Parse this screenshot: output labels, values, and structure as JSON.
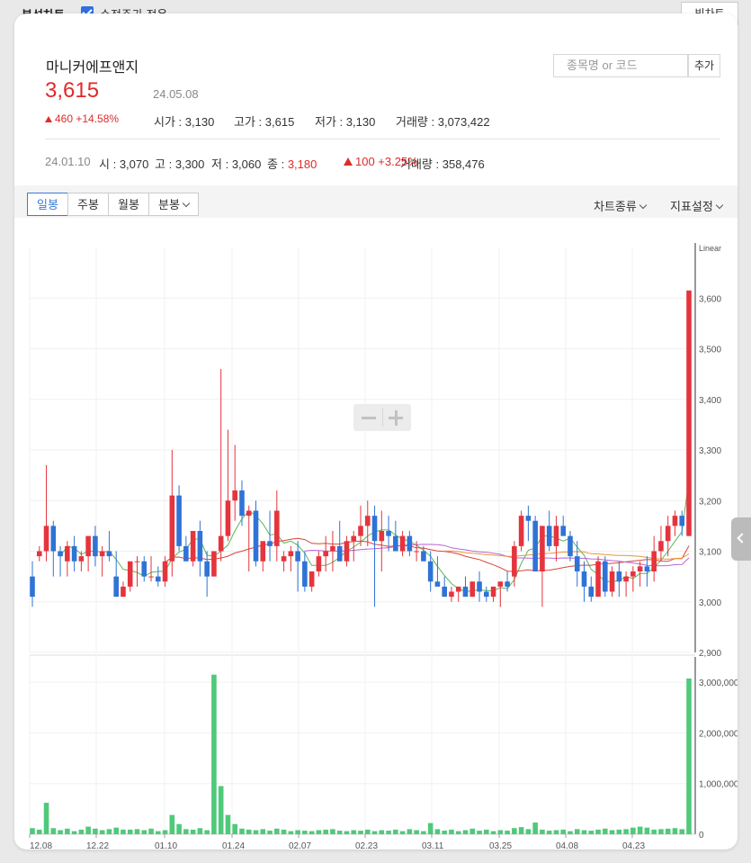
{
  "topbar": {
    "title": "분석차트",
    "adjusted_label": "수정주가 적용",
    "big_chart_label": "빅차트"
  },
  "stock": {
    "name": "마니커에프앤지",
    "price": "3,615",
    "date": "24.05.08",
    "change": "460 +14.58%",
    "ohlc": [
      {
        "label": "시가",
        "value": "3,130"
      },
      {
        "label": "고가",
        "value": "3,615"
      },
      {
        "label": "저가",
        "value": "3,130"
      },
      {
        "label": "거래량",
        "value": "3,073,422"
      }
    ]
  },
  "search": {
    "placeholder": "종목명 or 코드",
    "add_label": "추가"
  },
  "history": {
    "date": "24.01.10",
    "open_label": "시",
    "open": "3,070",
    "high_label": "고",
    "high": "3,300",
    "low_label": "저",
    "low": "3,060",
    "close_label": "종",
    "close": "3,180",
    "change": "100 +3.25%",
    "volume_label": "거래량",
    "volume": "358,476"
  },
  "tabs": [
    "일봉",
    "주봉",
    "월봉",
    "분봉"
  ],
  "menus": {
    "chart_type": "차트종류",
    "indicator": "지표설정"
  },
  "colors": {
    "up": "#e5343d",
    "down": "#2f73d6",
    "ma5": "#5ab65a",
    "ma20": "#d9453b",
    "ma60": "#b665d6",
    "ma120": "#e8963a",
    "volume": "#4fc97a"
  },
  "chart_data": [
    {
      "type": "candlestick",
      "scale_label": "Linear",
      "ylim": [
        2900,
        3700
      ],
      "yticks": [
        "3,600",
        "3,500",
        "3,400",
        "3,300",
        "3,200",
        "3,100",
        "3,000",
        "2,900"
      ],
      "xticks": [
        "12.08",
        "12.22",
        "01.10",
        "01.24",
        "02.07",
        "02.23",
        "03.11",
        "03.25",
        "04.08",
        "04.23"
      ],
      "candles": [
        [
          3050,
          3080,
          2990,
          3010
        ],
        [
          3090,
          3110,
          3080,
          3100
        ],
        [
          3100,
          3270,
          3080,
          3150
        ],
        [
          3150,
          3160,
          3050,
          3100
        ],
        [
          3100,
          3110,
          3050,
          3090
        ],
        [
          3080,
          3120,
          3050,
          3110
        ],
        [
          3110,
          3130,
          3060,
          3080
        ],
        [
          3080,
          3100,
          3060,
          3090
        ],
        [
          3090,
          3110,
          3060,
          3130
        ],
        [
          3130,
          3150,
          3070,
          3090
        ],
        [
          3090,
          3110,
          3050,
          3100
        ],
        [
          3100,
          3140,
          3080,
          3090
        ],
        [
          3050,
          3100,
          3030,
          3010
        ],
        [
          3010,
          3040,
          3010,
          3030
        ],
        [
          3030,
          3060,
          3020,
          3080
        ],
        [
          3080,
          3090,
          3030,
          3080
        ],
        [
          3080,
          3090,
          3040,
          3050
        ],
        [
          3050,
          3090,
          3040,
          3050
        ],
        [
          3050,
          3070,
          3030,
          3040
        ],
        [
          3040,
          3090,
          3030,
          3080
        ],
        [
          3080,
          3300,
          3050,
          3210
        ],
        [
          3210,
          3230,
          3100,
          3110
        ],
        [
          3110,
          3130,
          3080,
          3080
        ],
        [
          3080,
          3120,
          3070,
          3140
        ],
        [
          3140,
          3160,
          3050,
          3080
        ],
        [
          3080,
          3100,
          3010,
          3050
        ],
        [
          3050,
          3100,
          3060,
          3100
        ],
        [
          3100,
          3460,
          3080,
          3130
        ],
        [
          3130,
          3340,
          3120,
          3200
        ],
        [
          3200,
          3310,
          3160,
          3220
        ],
        [
          3220,
          3240,
          3150,
          3170
        ],
        [
          3170,
          3190,
          3060,
          3180
        ],
        [
          3180,
          3200,
          3070,
          3080
        ],
        [
          3080,
          3110,
          3060,
          3120
        ],
        [
          3120,
          3180,
          3080,
          3110
        ],
        [
          3110,
          3220,
          3080,
          3180
        ],
        [
          3080,
          3100,
          3060,
          3090
        ],
        [
          3090,
          3110,
          3060,
          3100
        ],
        [
          3100,
          3120,
          3020,
          3080
        ],
        [
          3080,
          3100,
          3020,
          3030
        ],
        [
          3030,
          3060,
          3020,
          3060
        ],
        [
          3060,
          3100,
          3050,
          3090
        ],
        [
          3090,
          3130,
          3060,
          3100
        ],
        [
          3100,
          3140,
          3060,
          3110
        ],
        [
          3110,
          3160,
          3080,
          3080
        ],
        [
          3080,
          3130,
          3070,
          3120
        ],
        [
          3120,
          3140,
          3080,
          3130
        ],
        [
          3130,
          3190,
          3110,
          3150
        ],
        [
          3150,
          3200,
          3110,
          3170
        ],
        [
          3170,
          3190,
          2990,
          3120
        ],
        [
          3120,
          3180,
          3060,
          3140
        ],
        [
          3140,
          3170,
          3100,
          3130
        ],
        [
          3130,
          3160,
          3100,
          3100
        ],
        [
          3100,
          3140,
          3090,
          3130
        ],
        [
          3130,
          3140,
          3090,
          3100
        ],
        [
          3100,
          3120,
          3080,
          3100
        ],
        [
          3100,
          3110,
          3090,
          3080
        ],
        [
          3080,
          3100,
          3020,
          3040
        ],
        [
          3040,
          3090,
          3030,
          3030
        ],
        [
          3030,
          3050,
          3010,
          3010
        ],
        [
          3010,
          3030,
          3000,
          3020
        ],
        [
          3020,
          3030,
          3000,
          3030
        ],
        [
          3030,
          3050,
          3010,
          3010
        ],
        [
          3010,
          3040,
          3010,
          3040
        ],
        [
          3040,
          3060,
          3000,
          3020
        ],
        [
          3020,
          3030,
          3000,
          3010
        ],
        [
          3010,
          3030,
          3000,
          3030
        ],
        [
          3030,
          3040,
          2990,
          3040
        ],
        [
          3040,
          3060,
          3020,
          3030
        ],
        [
          3050,
          3120,
          3030,
          3110
        ],
        [
          3110,
          3180,
          3100,
          3170
        ],
        [
          3170,
          3190,
          3120,
          3160
        ],
        [
          3160,
          3170,
          3060,
          3060
        ],
        [
          3060,
          3140,
          2990,
          3150
        ],
        [
          3150,
          3180,
          3100,
          3110
        ],
        [
          3110,
          3170,
          3080,
          3150
        ],
        [
          3150,
          3170,
          3130,
          3130
        ],
        [
          3130,
          3140,
          3080,
          3090
        ],
        [
          3090,
          3120,
          3030,
          3060
        ],
        [
          3060,
          3080,
          3000,
          3030
        ],
        [
          3030,
          3050,
          3000,
          3010
        ],
        [
          3010,
          3090,
          3010,
          3080
        ],
        [
          3080,
          3090,
          3010,
          3020
        ],
        [
          3020,
          3070,
          3010,
          3060
        ],
        [
          3060,
          3080,
          3010,
          3040
        ],
        [
          3040,
          3060,
          3010,
          3050
        ],
        [
          3050,
          3070,
          3020,
          3060
        ],
        [
          3060,
          3080,
          3030,
          3070
        ],
        [
          3070,
          3090,
          3030,
          3060
        ],
        [
          3060,
          3130,
          3040,
          3100
        ],
        [
          3100,
          3150,
          3080,
          3120
        ],
        [
          3120,
          3170,
          3090,
          3150
        ],
        [
          3150,
          3180,
          3130,
          3170
        ],
        [
          3170,
          3180,
          3130,
          3150
        ],
        [
          3130,
          3615,
          3130,
          3615
        ]
      ]
    },
    {
      "type": "bar",
      "title": "",
      "ylim": [
        0,
        3500000
      ],
      "yticks": [
        "3,000,000",
        "2,000,000",
        "1,000,000",
        "0"
      ],
      "values": [
        120000,
        90000,
        620000,
        120000,
        80000,
        110000,
        60000,
        90000,
        150000,
        110000,
        80000,
        100000,
        130000,
        90000,
        90000,
        100000,
        80000,
        110000,
        60000,
        80000,
        380000,
        200000,
        100000,
        90000,
        120000,
        80000,
        3150000,
        950000,
        380000,
        200000,
        110000,
        90000,
        80000,
        100000,
        70000,
        110000,
        90000,
        60000,
        80000,
        70000,
        60000,
        80000,
        90000,
        100000,
        70000,
        60000,
        80000,
        70000,
        90000,
        60000,
        80000,
        70000,
        90000,
        60000,
        100000,
        80000,
        60000,
        220000,
        100000,
        70000,
        90000,
        60000,
        80000,
        110000,
        70000,
        90000,
        60000,
        80000,
        70000,
        120000,
        140000,
        100000,
        230000,
        90000,
        70000,
        80000,
        90000,
        60000,
        100000,
        80000,
        70000,
        90000,
        110000,
        80000,
        90000,
        100000,
        130000,
        150000,
        130000,
        90000,
        100000,
        110000,
        120000,
        100000,
        3073422
      ]
    }
  ]
}
